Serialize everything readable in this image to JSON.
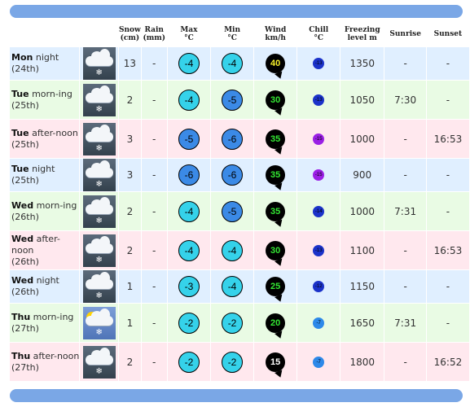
{
  "headers": [
    {
      "line1": "Snow",
      "line2": "(cm)"
    },
    {
      "line1": "Rain",
      "line2": "(mm)"
    },
    {
      "line1": "Max",
      "line2": "°C"
    },
    {
      "line1": "Min",
      "line2": "°C"
    },
    {
      "line1": "Wind",
      "line2": "km/h"
    },
    {
      "line1": "Chill",
      "line2": "°C"
    },
    {
      "line1": "Freezing",
      "line2": "level m"
    },
    {
      "line1": "Sunrise",
      "line2": ""
    },
    {
      "line1": "Sunset",
      "line2": ""
    }
  ],
  "rows": [
    {
      "day": "Mon",
      "period": "night",
      "date": "(24th)",
      "snow": "13",
      "rain": "-",
      "max": "-4",
      "min": "-4",
      "wind": "40",
      "chill": "-13",
      "freezing": "1350",
      "sunrise": "-",
      "sunset": "-",
      "theme": "blue",
      "icon": "snow-cloud-icon",
      "maxColor": "#35d2ea",
      "minColor": "#35d2ea",
      "windColor": "#f5ef2a",
      "chillColor": "#1b32c9",
      "sky": "dark"
    },
    {
      "day": "Tue",
      "period": "morn-ing",
      "date": "(25th)",
      "snow": "2",
      "rain": "-",
      "max": "-4",
      "min": "-5",
      "wind": "30",
      "chill": "-13",
      "freezing": "1050",
      "sunrise": "7:30",
      "sunset": "-",
      "theme": "green",
      "icon": "snow-cloud-icon",
      "maxColor": "#35d2ea",
      "minColor": "#3b8ae6",
      "windColor": "#33e633",
      "chillColor": "#1b32c9",
      "sky": "dark"
    },
    {
      "day": "Tue",
      "period": "after-noon",
      "date": "(25th)",
      "snow": "3",
      "rain": "-",
      "max": "-5",
      "min": "-6",
      "wind": "35",
      "chill": "-15",
      "freezing": "1000",
      "sunrise": "-",
      "sunset": "16:53",
      "theme": "pink",
      "icon": "snow-cloud-icon",
      "maxColor": "#3b8ae6",
      "minColor": "#3b8ae6",
      "windColor": "#33e633",
      "chillColor": "#9b1fe5",
      "sky": "dark"
    },
    {
      "day": "Tue",
      "period": "night",
      "date": "(25th)",
      "snow": "3",
      "rain": "-",
      "max": "-6",
      "min": "-6",
      "wind": "35",
      "chill": "-15",
      "freezing": "900",
      "sunrise": "-",
      "sunset": "-",
      "theme": "blue",
      "icon": "snow-cloud-icon",
      "maxColor": "#3b8ae6",
      "minColor": "#3b8ae6",
      "windColor": "#33e633",
      "chillColor": "#9b1fe5",
      "sky": "dark"
    },
    {
      "day": "Wed",
      "period": "morn-ing",
      "date": "(26th)",
      "snow": "2",
      "rain": "-",
      "max": "-4",
      "min": "-5",
      "wind": "35",
      "chill": "-14",
      "freezing": "1000",
      "sunrise": "7:31",
      "sunset": "-",
      "theme": "green",
      "icon": "snow-cloud-icon",
      "maxColor": "#35d2ea",
      "minColor": "#3b8ae6",
      "windColor": "#33e633",
      "chillColor": "#1b32c9",
      "sky": "dark"
    },
    {
      "day": "Wed",
      "period": "after-noon",
      "date": "(26th)",
      "snow": "2",
      "rain": "-",
      "max": "-4",
      "min": "-4",
      "wind": "30",
      "chill": "-13",
      "freezing": "1100",
      "sunrise": "-",
      "sunset": "16:53",
      "theme": "pink",
      "icon": "snow-cloud-icon",
      "maxColor": "#35d2ea",
      "minColor": "#35d2ea",
      "windColor": "#33e633",
      "chillColor": "#1b32c9",
      "sky": "dark"
    },
    {
      "day": "Wed",
      "period": "night",
      "date": "(26th)",
      "snow": "1",
      "rain": "-",
      "max": "-3",
      "min": "-4",
      "wind": "25",
      "chill": "-12",
      "freezing": "1150",
      "sunrise": "-",
      "sunset": "-",
      "theme": "blue",
      "icon": "snow-cloud-icon",
      "maxColor": "#35d2ea",
      "minColor": "#35d2ea",
      "windColor": "#33e633",
      "chillColor": "#1b32c9",
      "sky": "dark"
    },
    {
      "day": "Thu",
      "period": "morn-ing",
      "date": "(27th)",
      "snow": "1",
      "rain": "-",
      "max": "-2",
      "min": "-2",
      "wind": "20",
      "chill": "-7",
      "freezing": "1650",
      "sunrise": "7:31",
      "sunset": "-",
      "theme": "green",
      "icon": "sun-snow-cloud-icon",
      "maxColor": "#35d2ea",
      "minColor": "#35d2ea",
      "windColor": "#33e633",
      "chillColor": "#2d89e9",
      "sky": "sunny"
    },
    {
      "day": "Thu",
      "period": "after-noon",
      "date": "(27th)",
      "snow": "2",
      "rain": "-",
      "max": "-2",
      "min": "-2",
      "wind": "15",
      "chill": "-7",
      "freezing": "1800",
      "sunrise": "-",
      "sunset": "16:52",
      "theme": "pink",
      "icon": "snow-cloud-icon",
      "maxColor": "#35d2ea",
      "minColor": "#35d2ea",
      "windColor": "#ffffff",
      "chillColor": "#2d89e9",
      "sky": "dark"
    }
  ]
}
